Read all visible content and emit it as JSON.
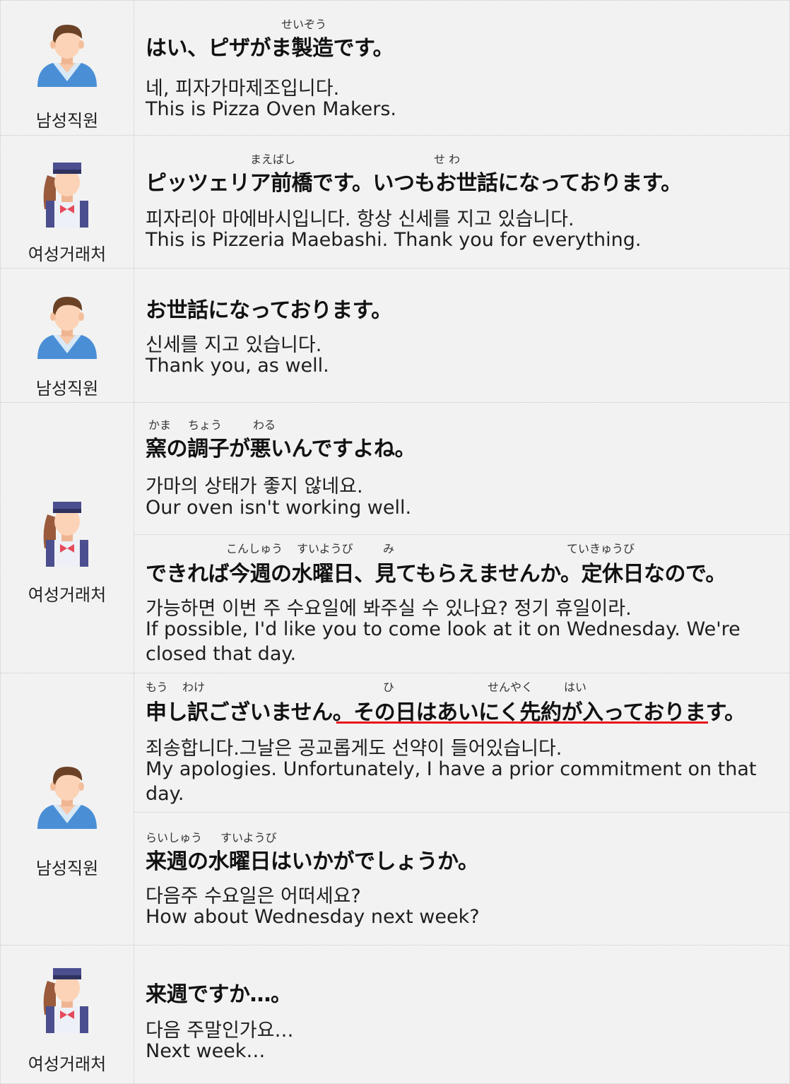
{
  "speakers": {
    "male": "남성직원",
    "female": "여성거래처"
  },
  "turns": [
    {
      "speaker": "male",
      "utterances": [
        {
          "ruby": [
            "せいぞう"
          ],
          "jp": "はい、ピザがま製造です。",
          "ko": "네, 피자가마제조입니다.",
          "en": "This is Pizza Oven Makers."
        }
      ]
    },
    {
      "speaker": "female",
      "utterances": [
        {
          "ruby": [
            "まえばし",
            "せ わ"
          ],
          "jp": "ピッツェリア前橋です。いつもお世話になっております。",
          "ko": "피자리아 마에바시입니다. 항상 신세를 지고 있습니다.",
          "en": "This is Pizzeria Maebashi. Thank you for everything."
        }
      ]
    },
    {
      "speaker": "male",
      "utterances": [
        {
          "ruby": [],
          "jp": "お世話になっております。",
          "ko": "신세를 지고 있습니다.",
          "en": "Thank you, as well."
        }
      ]
    },
    {
      "speaker": "female",
      "utterances": [
        {
          "ruby": [
            "かま",
            "ちょう",
            "わる"
          ],
          "jp": "窯の調子が悪いんですよね。",
          "ko": "가마의 상태가 좋지 않네요.",
          "en": "Our oven isn't working well."
        },
        {
          "ruby": [
            "こんしゅう",
            "すいようび",
            "み",
            "ていきゅうび"
          ],
          "jp": "できれば今週の水曜日、見てもらえませんか。定休日なので。",
          "ko": "가능하면 이번 주 수요일에 봐주실 수 있나요? 정기 휴일이라.",
          "en": "If possible, I'd like you to come look at it on Wednesday. We're closed that day."
        }
      ]
    },
    {
      "speaker": "male",
      "utterances": [
        {
          "ruby": [
            "もう",
            "わけ",
            "ひ",
            "せんやく",
            "はい"
          ],
          "jp_a": "申し訳ございません。",
          "jp_b": "その日はあいにく先約が入っております。",
          "ko": "죄송합니다.그날은 공교롭게도 선약이 들어있습니다.",
          "en": "My apologies. Unfortunately, I have a prior commitment on that day."
        },
        {
          "ruby": [
            "らいしゅう",
            "すいようび"
          ],
          "jp": "来週の水曜日はいかがでしょうか。",
          "ko": "다음주 수요일은 어떠세요?",
          "en": "How about Wednesday next week?"
        }
      ]
    },
    {
      "speaker": "female",
      "utterances": [
        {
          "ruby": [],
          "jp": "来週ですか…。",
          "ko": "다음 주말인가요…",
          "en": "Next week…"
        }
      ]
    }
  ],
  "colors": {
    "background": "#f2f2f2",
    "underline": "#e8111b",
    "male_shirt": "#4a8fd6",
    "female_vest": "#4b4f8f"
  }
}
